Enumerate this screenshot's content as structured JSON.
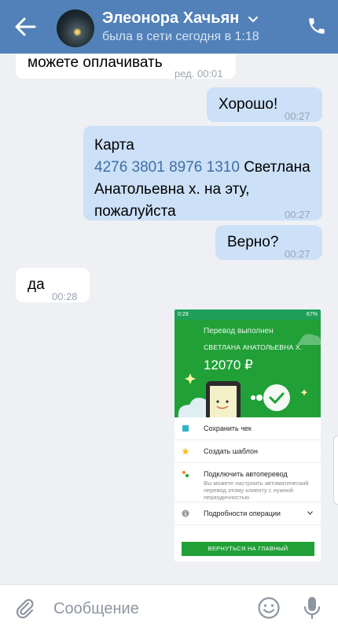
{
  "header": {
    "name": "Элеонора Хачьян",
    "status": "была в сети сегодня в 1:18"
  },
  "messages": {
    "m1": {
      "text": "можете оплачивать",
      "time": "ред. 00:01"
    },
    "m2": {
      "text": "Хорошо!",
      "time": "00:27"
    },
    "m3": {
      "line1": "Карта",
      "card": "4276 3801 8976 1310",
      "line2_rest": " Светлана",
      "line3": "Анатольевна х. на эту,",
      "line4": "пожалуйста",
      "time": "00:27"
    },
    "m4": {
      "text": "Верно?",
      "time": "00:27"
    },
    "m5": {
      "text": "да",
      "time": "00:28"
    }
  },
  "receipt": {
    "status_time": "0:29",
    "status_battery": "67%",
    "title": "Перевод выполнен",
    "recipient": "СВЕТЛАНА АНАТОЛЬЕВНА Х.",
    "amount": "12070 ₽",
    "items": [
      {
        "label": "Сохранить чек",
        "icon": "receipt-icon"
      },
      {
        "label": "Создать шаблон",
        "icon": "star-icon"
      },
      {
        "label": "Подключить автоперевод",
        "icon": "autotransfer-icon",
        "sub": "Вы можете настроить автоматический перевод этому клиенту с нужной периодичностью"
      },
      {
        "label": "Подробности операции",
        "icon": "info-icon"
      }
    ],
    "button": "ВЕРНУТЬСЯ НА ГЛАВНЫЙ",
    "colors": {
      "green": "#21a038"
    }
  },
  "composer": {
    "placeholder": "Сообщение"
  },
  "colors": {
    "header": "#5181b8",
    "outgoing": "#cce0f8",
    "incoming": "#ffffff",
    "background": "#eef0f3"
  }
}
